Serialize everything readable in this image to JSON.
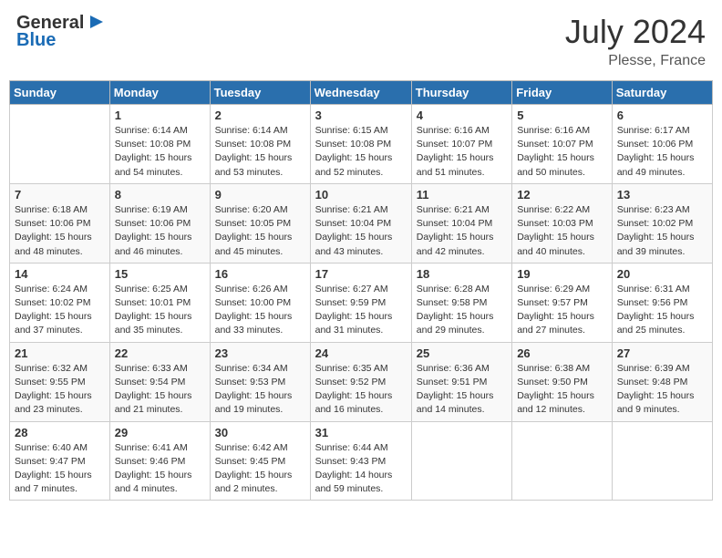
{
  "header": {
    "logo_general": "General",
    "logo_blue": "Blue",
    "month": "July 2024",
    "location": "Plesse, France"
  },
  "weekdays": [
    "Sunday",
    "Monday",
    "Tuesday",
    "Wednesday",
    "Thursday",
    "Friday",
    "Saturday"
  ],
  "weeks": [
    [
      {
        "day": "",
        "info": ""
      },
      {
        "day": "1",
        "info": "Sunrise: 6:14 AM\nSunset: 10:08 PM\nDaylight: 15 hours\nand 54 minutes."
      },
      {
        "day": "2",
        "info": "Sunrise: 6:14 AM\nSunset: 10:08 PM\nDaylight: 15 hours\nand 53 minutes."
      },
      {
        "day": "3",
        "info": "Sunrise: 6:15 AM\nSunset: 10:08 PM\nDaylight: 15 hours\nand 52 minutes."
      },
      {
        "day": "4",
        "info": "Sunrise: 6:16 AM\nSunset: 10:07 PM\nDaylight: 15 hours\nand 51 minutes."
      },
      {
        "day": "5",
        "info": "Sunrise: 6:16 AM\nSunset: 10:07 PM\nDaylight: 15 hours\nand 50 minutes."
      },
      {
        "day": "6",
        "info": "Sunrise: 6:17 AM\nSunset: 10:06 PM\nDaylight: 15 hours\nand 49 minutes."
      }
    ],
    [
      {
        "day": "7",
        "info": "Sunrise: 6:18 AM\nSunset: 10:06 PM\nDaylight: 15 hours\nand 48 minutes."
      },
      {
        "day": "8",
        "info": "Sunrise: 6:19 AM\nSunset: 10:06 PM\nDaylight: 15 hours\nand 46 minutes."
      },
      {
        "day": "9",
        "info": "Sunrise: 6:20 AM\nSunset: 10:05 PM\nDaylight: 15 hours\nand 45 minutes."
      },
      {
        "day": "10",
        "info": "Sunrise: 6:21 AM\nSunset: 10:04 PM\nDaylight: 15 hours\nand 43 minutes."
      },
      {
        "day": "11",
        "info": "Sunrise: 6:21 AM\nSunset: 10:04 PM\nDaylight: 15 hours\nand 42 minutes."
      },
      {
        "day": "12",
        "info": "Sunrise: 6:22 AM\nSunset: 10:03 PM\nDaylight: 15 hours\nand 40 minutes."
      },
      {
        "day": "13",
        "info": "Sunrise: 6:23 AM\nSunset: 10:02 PM\nDaylight: 15 hours\nand 39 minutes."
      }
    ],
    [
      {
        "day": "14",
        "info": "Sunrise: 6:24 AM\nSunset: 10:02 PM\nDaylight: 15 hours\nand 37 minutes."
      },
      {
        "day": "15",
        "info": "Sunrise: 6:25 AM\nSunset: 10:01 PM\nDaylight: 15 hours\nand 35 minutes."
      },
      {
        "day": "16",
        "info": "Sunrise: 6:26 AM\nSunset: 10:00 PM\nDaylight: 15 hours\nand 33 minutes."
      },
      {
        "day": "17",
        "info": "Sunrise: 6:27 AM\nSunset: 9:59 PM\nDaylight: 15 hours\nand 31 minutes."
      },
      {
        "day": "18",
        "info": "Sunrise: 6:28 AM\nSunset: 9:58 PM\nDaylight: 15 hours\nand 29 minutes."
      },
      {
        "day": "19",
        "info": "Sunrise: 6:29 AM\nSunset: 9:57 PM\nDaylight: 15 hours\nand 27 minutes."
      },
      {
        "day": "20",
        "info": "Sunrise: 6:31 AM\nSunset: 9:56 PM\nDaylight: 15 hours\nand 25 minutes."
      }
    ],
    [
      {
        "day": "21",
        "info": "Sunrise: 6:32 AM\nSunset: 9:55 PM\nDaylight: 15 hours\nand 23 minutes."
      },
      {
        "day": "22",
        "info": "Sunrise: 6:33 AM\nSunset: 9:54 PM\nDaylight: 15 hours\nand 21 minutes."
      },
      {
        "day": "23",
        "info": "Sunrise: 6:34 AM\nSunset: 9:53 PM\nDaylight: 15 hours\nand 19 minutes."
      },
      {
        "day": "24",
        "info": "Sunrise: 6:35 AM\nSunset: 9:52 PM\nDaylight: 15 hours\nand 16 minutes."
      },
      {
        "day": "25",
        "info": "Sunrise: 6:36 AM\nSunset: 9:51 PM\nDaylight: 15 hours\nand 14 minutes."
      },
      {
        "day": "26",
        "info": "Sunrise: 6:38 AM\nSunset: 9:50 PM\nDaylight: 15 hours\nand 12 minutes."
      },
      {
        "day": "27",
        "info": "Sunrise: 6:39 AM\nSunset: 9:48 PM\nDaylight: 15 hours\nand 9 minutes."
      }
    ],
    [
      {
        "day": "28",
        "info": "Sunrise: 6:40 AM\nSunset: 9:47 PM\nDaylight: 15 hours\nand 7 minutes."
      },
      {
        "day": "29",
        "info": "Sunrise: 6:41 AM\nSunset: 9:46 PM\nDaylight: 15 hours\nand 4 minutes."
      },
      {
        "day": "30",
        "info": "Sunrise: 6:42 AM\nSunset: 9:45 PM\nDaylight: 15 hours\nand 2 minutes."
      },
      {
        "day": "31",
        "info": "Sunrise: 6:44 AM\nSunset: 9:43 PM\nDaylight: 14 hours\nand 59 minutes."
      },
      {
        "day": "",
        "info": ""
      },
      {
        "day": "",
        "info": ""
      },
      {
        "day": "",
        "info": ""
      }
    ]
  ]
}
